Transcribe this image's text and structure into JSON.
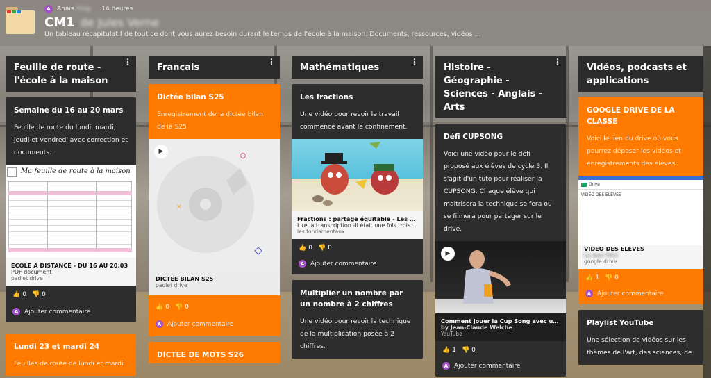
{
  "board": {
    "author_initial": "A",
    "author_name": "Anaïs",
    "author_name_blurred": "Fmg",
    "time": "14 heures",
    "title": "CM1",
    "title_blurred": "de Jules Verne",
    "subtitle": "Un tableau récapitulatif de tout ce dont vous aurez besoin durant le temps de l'école à la maison. Documents, ressources, vidéos ..."
  },
  "ui": {
    "comment_label": "Ajouter commentaire",
    "menu_glyph": "⋮",
    "thumb_up": "👍",
    "thumb_down": "👎",
    "play_glyph": "▶"
  },
  "columns": [
    {
      "title": "Feuille de route - l'école à la maison",
      "cards": [
        {
          "title": "Semaine du 16 au 20 mars",
          "body": "Feuille de route du lundi, mardi, jeudi et vendredi avec correction et documents.",
          "attachment": {
            "preview_heading": "Ma feuille de route à la maison",
            "name": "ECOLE A DISTANCE - DU 16 AU 20:03",
            "type": "PDF document",
            "source": "padlet drive"
          },
          "likes": "0",
          "dislikes": "0"
        },
        {
          "title": "Lundi 23 et mardi 24",
          "body": "Feuilles de route de lundi et mardi",
          "orange": true
        }
      ]
    },
    {
      "title": "Français",
      "cards": [
        {
          "title": "Dictée bilan S25",
          "body": "Enregistrement de la dictée bilan de la S25",
          "orange": true,
          "attachment": {
            "name": "DICTEE BILAN S25",
            "source": "padlet drive"
          },
          "likes": "0",
          "dislikes": "0"
        },
        {
          "title": "DICTEE DE MOTS S26",
          "orange": true
        }
      ]
    },
    {
      "title": "Mathématiques",
      "cards": [
        {
          "title": "Les fractions",
          "body": "Une vidéo pour revoir le travail commencé avant le confinement.",
          "attachment": {
            "name": "Fractions : partage équitable - Les anim...",
            "desc": "Lire la transcription -Il était une fois trois ...",
            "source": "les fondamentaux"
          },
          "likes": "0",
          "dislikes": "0"
        },
        {
          "title": "Multiplier un nombre par un nombre à 2 chiffres",
          "body": "Une vidéo pour revoir la technique de la multiplication posée à 2 chiffres."
        }
      ]
    },
    {
      "title": "Histoire - Géographie - Sciences - Anglais - Arts",
      "cards": [
        {
          "title": "Défi CUPSONG",
          "body": "Voici une vidéo pour le défi proposé aux élèves de cycle 3. Il s'agit d'un tuto pour réaliser la CUPSONG. Chaque élève qui maitrisera la technique se fera ou se filmera pour partager sur le drive.",
          "attachment": {
            "name": "Comment jouer la Cup Song avec un go...",
            "desc": "by Jean-Claude Welche",
            "source": "YouTube"
          },
          "likes": "1",
          "dislikes": "0"
        }
      ]
    },
    {
      "title": "Vidéos, podcasts et applications",
      "cards": [
        {
          "title": "GOOGLE DRIVE DE LA CLASSE",
          "body": "Voici le lien du drive où vous pourrez déposer les vidéos et enregistrements des élèves.",
          "orange": true,
          "attachment": {
            "drive_label": "Drive",
            "folder_label": "VIDEO DES ELEVES",
            "name": "VIDEO DES ELEVES",
            "desc": "by Jean-Paul",
            "source": "google drive"
          },
          "likes": "1",
          "dislikes": "0"
        },
        {
          "title": "Playlist YouTube",
          "body": "Une sélection de vidéos sur les thèmes de l'art, des sciences, de"
        }
      ]
    }
  ],
  "colors": {
    "orange": "#ff7a00",
    "card_dark": "#2d2d2d",
    "avatar": "#a552c9"
  }
}
